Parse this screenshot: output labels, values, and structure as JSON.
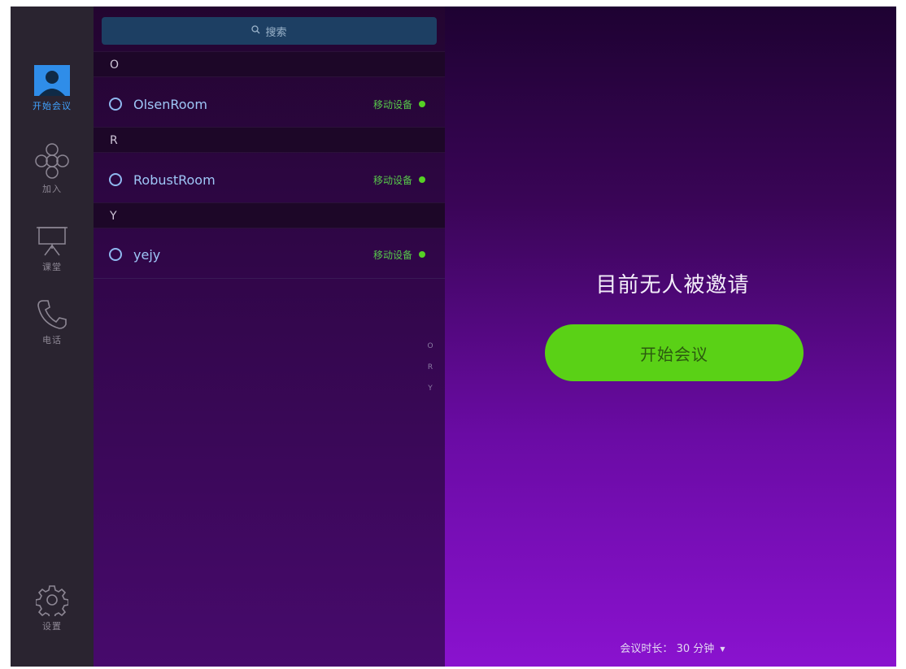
{
  "sidebar": {
    "items": [
      {
        "label": "开始会议",
        "icon": "person-icon",
        "active": true
      },
      {
        "label": "加入",
        "icon": "join-icon"
      },
      {
        "label": "课堂",
        "icon": "classroom-icon"
      },
      {
        "label": "电话",
        "icon": "phone-icon"
      }
    ],
    "settings_label": "设置"
  },
  "search": {
    "placeholder": "搜索"
  },
  "sections": [
    {
      "letter": "O",
      "contacts": [
        {
          "name": "OlsenRoom",
          "device": "移动设备"
        }
      ]
    },
    {
      "letter": "R",
      "contacts": [
        {
          "name": "RobustRoom",
          "device": "移动设备"
        }
      ]
    },
    {
      "letter": "Y",
      "contacts": [
        {
          "name": "yejy",
          "device": "移动设备"
        }
      ]
    }
  ],
  "index_letters": [
    "O",
    "R",
    "Y"
  ],
  "main": {
    "empty_title": "目前无人被邀请",
    "start_button": "开始会议",
    "duration_label": "会议时长：",
    "duration_value": "30 分钟"
  },
  "colors": {
    "accent_green": "#5ad116",
    "active_blue": "#41a3ff",
    "online_dot": "#56d125"
  }
}
